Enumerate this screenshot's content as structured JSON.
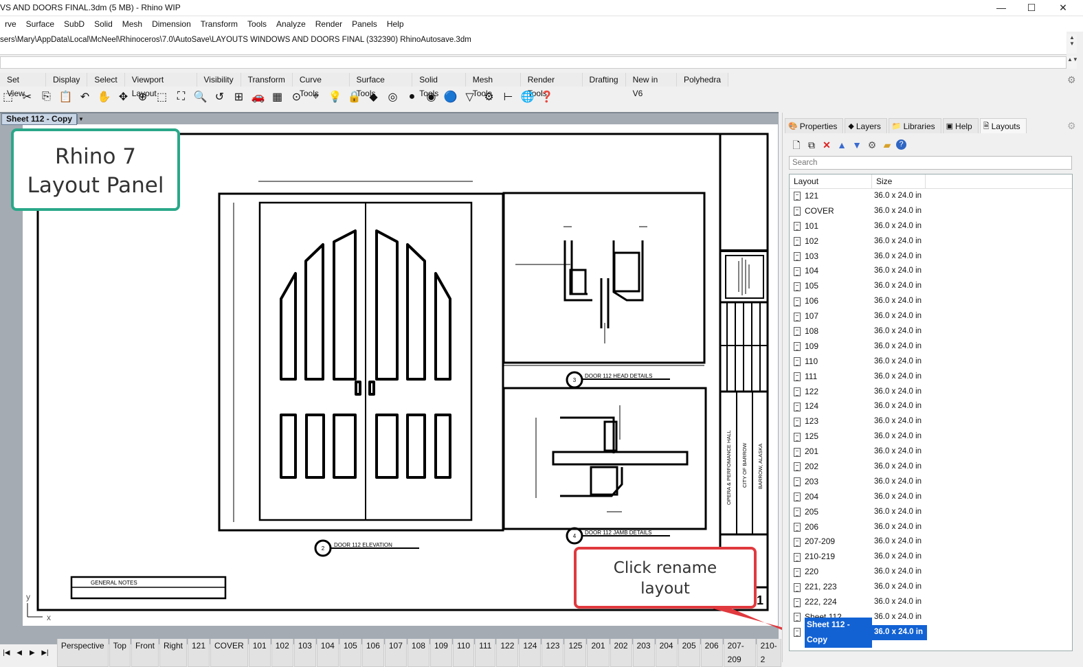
{
  "window": {
    "title": "VS AND DOORS FINAL.3dm (5 MB) - Rhino WIP",
    "minimize": "—",
    "maximize": "☐",
    "close": "✕"
  },
  "menu": [
    "rve",
    "Surface",
    "SubD",
    "Solid",
    "Mesh",
    "Dimension",
    "Transform",
    "Tools",
    "Analyze",
    "Render",
    "Panels",
    "Help"
  ],
  "command_history": "sers\\Mary\\AppData\\Local\\McNeel\\Rhinoceros\\7.0\\AutoSave\\LAYOUTS WINDOWS AND DOORS FINAL (332390) RhinoAutosave.3dm",
  "toolbar_tabs": [
    "Set View",
    "Display",
    "Select",
    "Viewport Layout",
    "Visibility",
    "Transform",
    "Curve Tools",
    "Surface Tools",
    "Solid Tools",
    "Mesh Tools",
    "Render Tools",
    "Drafting",
    "New in V6",
    "Polyhedra"
  ],
  "toolbar_icons": [
    "new-icon",
    "cut-icon",
    "copy-icon",
    "paste-icon",
    "undo-icon",
    "pan-icon",
    "rotate-icon",
    "zoom-in-icon",
    "zoom-window-icon",
    "zoom-extents-icon",
    "zoom-selected-icon",
    "undo-view-icon",
    "viewport-grid-icon",
    "car-icon",
    "analysis-icon",
    "osnap-icon",
    "gumball-icon",
    "light-icon",
    "lock-icon",
    "layer-icon",
    "color-wheel-icon",
    "shade-icon",
    "rendered-icon",
    "render-sphere-icon",
    "filter-icon",
    "options-gear-icon",
    "dimension-icon",
    "globe-icon",
    "help-icon"
  ],
  "viewport": {
    "tab": "Sheet 112 - Copy",
    "axis_x": "x",
    "axis_y": "y"
  },
  "drawing": {
    "detail2": "2",
    "detail2_title": "DOOR 112 ELEVATION",
    "detail3": "3",
    "detail3_title": "DOOR 112 HEAD DETAILS",
    "detail4": "4",
    "detail4_title": "DOOR 112 JAMB DETAILS",
    "general_notes": "GENERAL NOTES",
    "titleblock": [
      "OPERA & PERFOMANCE HALL",
      "CITY OF BARROW",
      "BARROW, ALASKA"
    ],
    "sheet_no": "1"
  },
  "bottom_tabs": [
    "Perspective",
    "Top",
    "Front",
    "Right",
    "121",
    "COVER",
    "101",
    "102",
    "103",
    "104",
    "105",
    "106",
    "107",
    "108",
    "109",
    "110",
    "111",
    "122",
    "124",
    "123",
    "125",
    "201",
    "202",
    "203",
    "204",
    "205",
    "206",
    "207-209",
    "210-2"
  ],
  "panel": {
    "tabs": [
      "Properties",
      "Layers",
      "Libraries",
      "Help",
      "Layouts"
    ],
    "active_tab": "Layouts",
    "search_placeholder": "Search",
    "columns": [
      "Layout",
      "Size"
    ],
    "layouts": [
      {
        "name": "121",
        "size": "36.0 x 24.0 in"
      },
      {
        "name": "COVER",
        "size": "36.0 x 24.0 in"
      },
      {
        "name": "101",
        "size": "36.0 x 24.0 in"
      },
      {
        "name": "102",
        "size": "36.0 x 24.0 in"
      },
      {
        "name": "103",
        "size": "36.0 x 24.0 in"
      },
      {
        "name": "104",
        "size": "36.0 x 24.0 in"
      },
      {
        "name": "105",
        "size": "36.0 x 24.0 in"
      },
      {
        "name": "106",
        "size": "36.0 x 24.0 in"
      },
      {
        "name": "107",
        "size": "36.0 x 24.0 in"
      },
      {
        "name": "108",
        "size": "36.0 x 24.0 in"
      },
      {
        "name": "109",
        "size": "36.0 x 24.0 in"
      },
      {
        "name": "110",
        "size": "36.0 x 24.0 in"
      },
      {
        "name": "111",
        "size": "36.0 x 24.0 in"
      },
      {
        "name": "122",
        "size": "36.0 x 24.0 in"
      },
      {
        "name": "124",
        "size": "36.0 x 24.0 in"
      },
      {
        "name": "123",
        "size": "36.0 x 24.0 in"
      },
      {
        "name": "125",
        "size": "36.0 x 24.0 in"
      },
      {
        "name": "201",
        "size": "36.0 x 24.0 in"
      },
      {
        "name": "202",
        "size": "36.0 x 24.0 in"
      },
      {
        "name": "203",
        "size": "36.0 x 24.0 in"
      },
      {
        "name": "204",
        "size": "36.0 x 24.0 in"
      },
      {
        "name": "205",
        "size": "36.0 x 24.0 in"
      },
      {
        "name": "206",
        "size": "36.0 x 24.0 in"
      },
      {
        "name": "207-209",
        "size": "36.0 x 24.0 in"
      },
      {
        "name": "210-219",
        "size": "36.0 x 24.0 in"
      },
      {
        "name": "220",
        "size": "36.0 x 24.0 in"
      },
      {
        "name": "221, 223",
        "size": "36.0 x 24.0 in"
      },
      {
        "name": "222, 224",
        "size": "36.0 x 24.0 in"
      },
      {
        "name": "Sheet 112",
        "size": "36.0 x 24.0 in"
      },
      {
        "name": "Sheet 112 - Copy",
        "size": "36.0 x 24.0 in",
        "selected": true
      }
    ]
  },
  "callouts": {
    "top": "Rhino 7 Layout Panel",
    "bottom": "Click rename layout"
  },
  "colors": {
    "teal": "#2aa889",
    "red": "#e0393e",
    "selection": "#1262d4"
  }
}
